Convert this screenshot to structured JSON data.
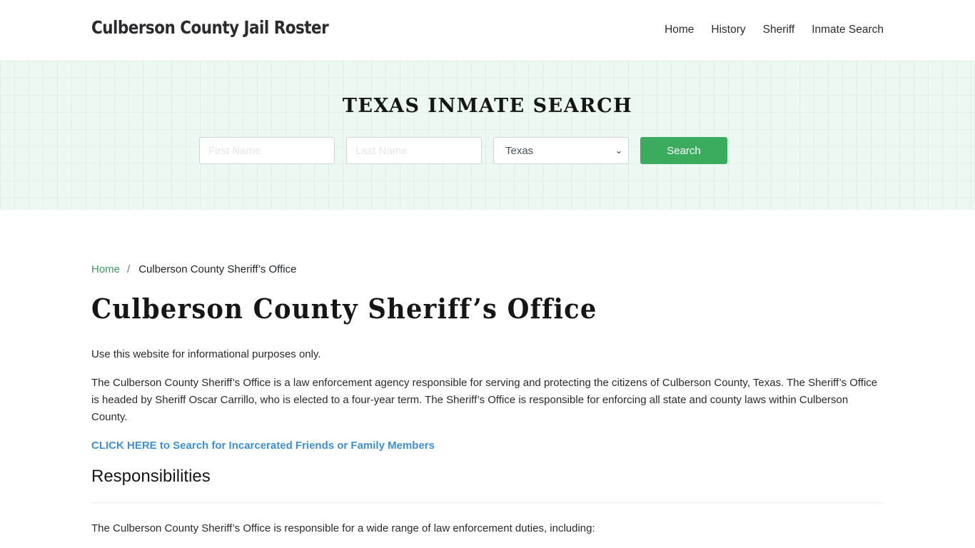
{
  "header": {
    "brand": "Culberson County Jail Roster",
    "nav": [
      {
        "label": "Home"
      },
      {
        "label": "History"
      },
      {
        "label": "Sheriff"
      },
      {
        "label": "Inmate Search"
      }
    ]
  },
  "hero": {
    "title": "TEXAS INMATE SEARCH",
    "first_name_placeholder": "First Name",
    "first_name_value": "",
    "last_name_placeholder": "Last Name",
    "last_name_value": "",
    "state_selected": "Texas",
    "search_label": "Search",
    "colors": {
      "background": "#ecf8f1",
      "button": "#3bab5e"
    }
  },
  "breadcrumb": {
    "home": "Home",
    "separator": "/",
    "current": "Culberson County Sheriff’s Office"
  },
  "main": {
    "title": "Culberson County Sheriff’s Office",
    "paragraphs": [
      "Use this website for informational purposes only.",
      "The Culberson County Sheriff’s Office is a law enforcement agency responsible for serving and protecting the citizens of Culberson County, Texas. The Sheriff’s Office is headed by Sheriff Oscar Carrillo, who is elected to a four-year term. The Sheriff’s Office is responsible for enforcing all state and county laws within Culberson County."
    ],
    "cta_link": "CLICK HERE to Search for Incarcerated Friends or Family Members",
    "section_heading": "Responsibilities",
    "section_paragraph": "The Culberson County Sheriff’s Office is responsible for a wide range of law enforcement duties, including:",
    "colors": {
      "link": "#3f8fd2",
      "breadcrumb_link": "#3d9a5c"
    }
  }
}
